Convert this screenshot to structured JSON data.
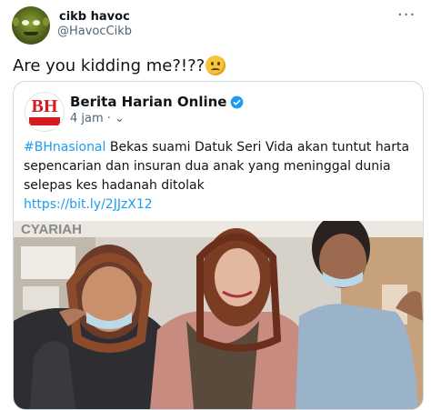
{
  "author": {
    "name": "cikb havoc",
    "handle": "@HavocCikb"
  },
  "more_icon": "more-horizontal-icon",
  "tweet": {
    "text": "Are you kidding me?!??",
    "emoji": "woozy-face-emoji"
  },
  "quoted": {
    "logo_text": "BH",
    "logo_subtext": "BeritaHarian",
    "author": "Berita Harian Online",
    "verified": true,
    "time": "4 jam",
    "separator": "·",
    "chevron_icon": "chevron-down-icon",
    "hashtag": "#BHnasional",
    "text": " Bekas suami Datuk Seri Vida akan tuntut harta sepencarian dan insuran dua anak yang meninggal dunia selepas kes hadanah ditolak",
    "link": "https://bit.ly/2JJzX12",
    "photo": {
      "sign_text": "CYARIAH",
      "description_icon": "news-photo-image"
    }
  },
  "colors": {
    "link": "#1d9bf0",
    "secondary": "#536471",
    "border": "#cfd9de",
    "brand_red": "#d71920"
  }
}
